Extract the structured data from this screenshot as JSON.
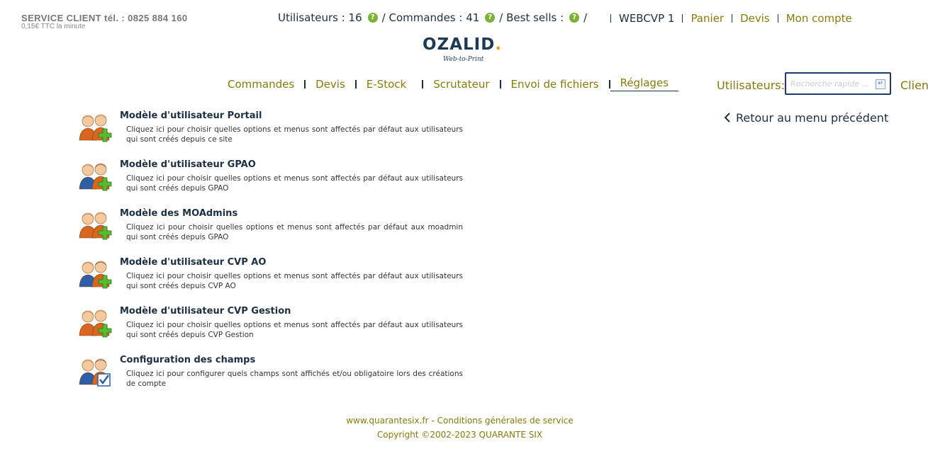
{
  "service": {
    "main": "SERVICE CLIENT tél. :  0825 884 160",
    "sub": "0,15€ TTC la minute"
  },
  "stats": {
    "users_label": "Utilisateurs : 16",
    "orders_label": "/ Commandes : 41",
    "best_label": "/ Best sells :",
    "best_tail": "/",
    "help_glyph": "?"
  },
  "toplinks": {
    "account_code": "WEBCVP 1",
    "cart": "Panier",
    "quotes": "Devis",
    "my_account": "Mon compte"
  },
  "logo": {
    "text": "OZALID",
    "dot": ".",
    "tagline": "Web-to-Print"
  },
  "nav": {
    "items": [
      "Commandes",
      "Devis",
      "E-Stock",
      "Scrutateur",
      "Envoi de fichiers",
      "Réglages"
    ]
  },
  "search": {
    "label": "Utilisateurs:",
    "placeholder": "Recherche rapide ...",
    "value": "",
    "enter_glyph": "↵",
    "client_label": "Client"
  },
  "back_link": "Retour au menu précédent",
  "models": [
    {
      "title": "Modèle d'utilisateur Portail",
      "desc": "Cliquez ici pour choisir quelles options et menus sont affectés par défaut aux utilisateurs qui sont créés depuis ce site",
      "icon": "users-add-icon",
      "alt": false
    },
    {
      "title": "Modèle d'utilisateur GPAO",
      "desc": "Cliquez ici pour choisir quelles options et menus sont affectés par défaut aux utilisateurs qui sont créés depuis GPAO",
      "icon": "users-add-icon",
      "alt": true
    },
    {
      "title": "Modèle des MOAdmins",
      "desc": "Cliquez ici pour choisir quelles options et menus sont affectés par défaut aux moadmin qui sont créés depuis GPAO",
      "icon": "users-add-icon",
      "alt": false
    },
    {
      "title": "Modèle d'utilisateur CVP AO",
      "desc": "Cliquez ici pour choisir quelles options et menus sont affectés par défaut aux utilisateurs qui sont créés depuis CVP AO",
      "icon": "users-add-icon",
      "alt": true
    },
    {
      "title": "Modèle d'utilisateur CVP Gestion",
      "desc": "Cliquez ici pour choisir quelles options et menus sont affectés par défaut aux utilisateurs qui sont créés depuis CVP Gestion",
      "icon": "users-add-icon",
      "alt": false
    },
    {
      "title": "Configuration des champs",
      "desc": "Cliquez ici pour configurer quels champs sont affichés et/ou obligatoire lors des créations de compte",
      "icon": "users-check-icon",
      "alt": true
    }
  ],
  "footer": {
    "site": "www.quarantesix.fr",
    "dash": "-",
    "terms": "Conditions générales de service",
    "copyright": "Copyright ©2002-2023 QUARANTE SIX"
  },
  "colors": {
    "gold": "#8a7a0a",
    "navy": "#1c2f44",
    "help_green": "#7bb233",
    "logo_dot": "#e8a21a"
  }
}
